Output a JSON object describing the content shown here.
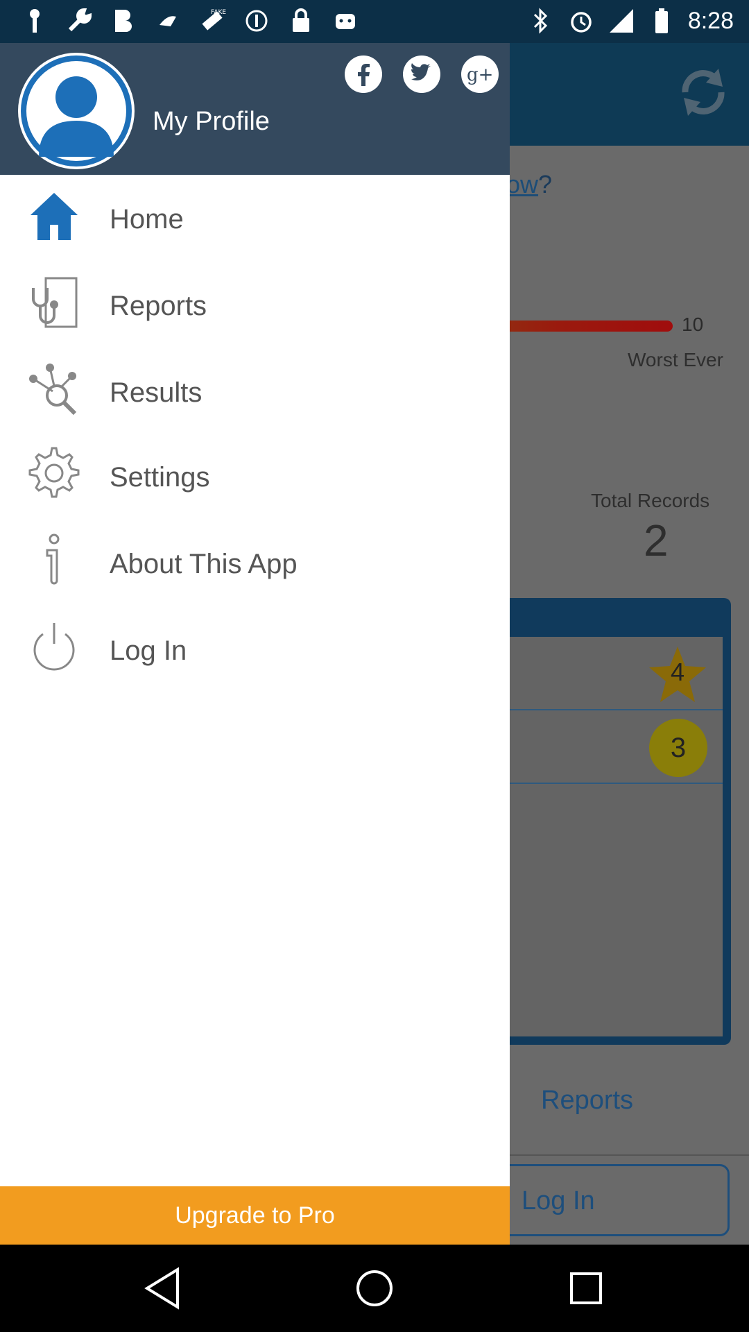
{
  "status_bar": {
    "time": "8:28",
    "left_icons": [
      "key-icon",
      "wrench-icon",
      "bold-b-icon",
      "swoosh-icon",
      "fake-gps-icon",
      "alert-circle-icon",
      "lock-icon",
      "android-icon"
    ],
    "right_icons": [
      "bluetooth-icon",
      "alarm-icon",
      "signal-icon",
      "battery-icon"
    ]
  },
  "background_app": {
    "question_suffix": "ow",
    "question_mark": "?",
    "scale_max": "10",
    "scale_label": "Worst Ever",
    "records_label": "Total Records",
    "records_value": "2",
    "star_value": "4",
    "circle_value": "3",
    "tab_reports": "Reports",
    "login_button": "Log In"
  },
  "drawer": {
    "profile_name": "My Profile",
    "social": [
      "facebook-icon",
      "twitter-icon",
      "google-plus-icon"
    ],
    "items": [
      {
        "label": "Home",
        "icon": "home-icon",
        "active": true
      },
      {
        "label": "Reports",
        "icon": "stethoscope-icon"
      },
      {
        "label": "Results",
        "icon": "results-search-icon"
      },
      {
        "label": "Settings",
        "icon": "gear-icon"
      },
      {
        "label": "About This App",
        "icon": "info-icon"
      },
      {
        "label": "Log In",
        "icon": "power-icon"
      }
    ],
    "upgrade_label": "Upgrade to Pro"
  },
  "colors": {
    "drawer_header": "#34495e",
    "accent": "#1d6fb8",
    "upgrade": "#f29c1f"
  }
}
